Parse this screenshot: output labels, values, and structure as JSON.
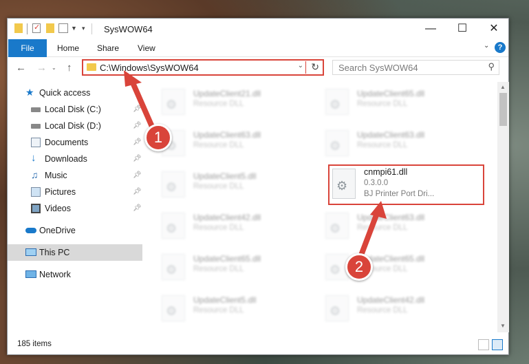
{
  "window": {
    "title": "SysWOW64"
  },
  "ribbon": {
    "file": "File",
    "home": "Home",
    "share": "Share",
    "view": "View",
    "help": "?"
  },
  "address": {
    "path": "C:\\Windows\\SysWOW64"
  },
  "search": {
    "placeholder": "Search SysWOW64"
  },
  "sidebar": {
    "items": [
      {
        "label": "Quick access",
        "icon": "star-icon"
      },
      {
        "label": "Local Disk (C:)",
        "icon": "drive-icon"
      },
      {
        "label": "Local Disk (D:)",
        "icon": "drive-icon"
      },
      {
        "label": "Documents",
        "icon": "documents-icon"
      },
      {
        "label": "Downloads",
        "icon": "download-icon"
      },
      {
        "label": "Music",
        "icon": "music-icon"
      },
      {
        "label": "Pictures",
        "icon": "pictures-icon"
      },
      {
        "label": "Videos",
        "icon": "videos-icon"
      },
      {
        "label": "OneDrive",
        "icon": "cloud-icon"
      },
      {
        "label": "This PC",
        "icon": "computer-icon"
      },
      {
        "label": "Network",
        "icon": "network-icon"
      }
    ]
  },
  "files": [
    {
      "name": "UpdateClient21.dll",
      "type": "Resource DLL"
    },
    {
      "name": "UpdateClient65.dll",
      "type": "Resource DLL"
    },
    {
      "name": "UpdateClient63.dll",
      "type": "Resource DLL"
    },
    {
      "name": "UpdateClient63.dll",
      "type": "Resource DLL"
    },
    {
      "name": "UpdateClient5.dll",
      "type": "Resource DLL"
    },
    {
      "name": "cnmpi61.dll",
      "version": "0.3.0.0",
      "type": "BJ Printer Port Dri..."
    },
    {
      "name": "UpdateClient42.dll",
      "type": "Resource DLL"
    },
    {
      "name": "UpdateClient63.dll",
      "type": "Resource DLL"
    },
    {
      "name": "UpdateClient65.dll",
      "type": "Resource DLL"
    },
    {
      "name": "UpdateClient65.dll",
      "type": "Resource DLL"
    },
    {
      "name": "UpdateClient5.dll",
      "type": "Resource DLL"
    },
    {
      "name": "UpdateClient42.dll",
      "type": "Resource DLL"
    }
  ],
  "status": {
    "count": "185 items"
  },
  "annotations": {
    "step1": "1",
    "step2": "2",
    "color": "#d9443a"
  }
}
